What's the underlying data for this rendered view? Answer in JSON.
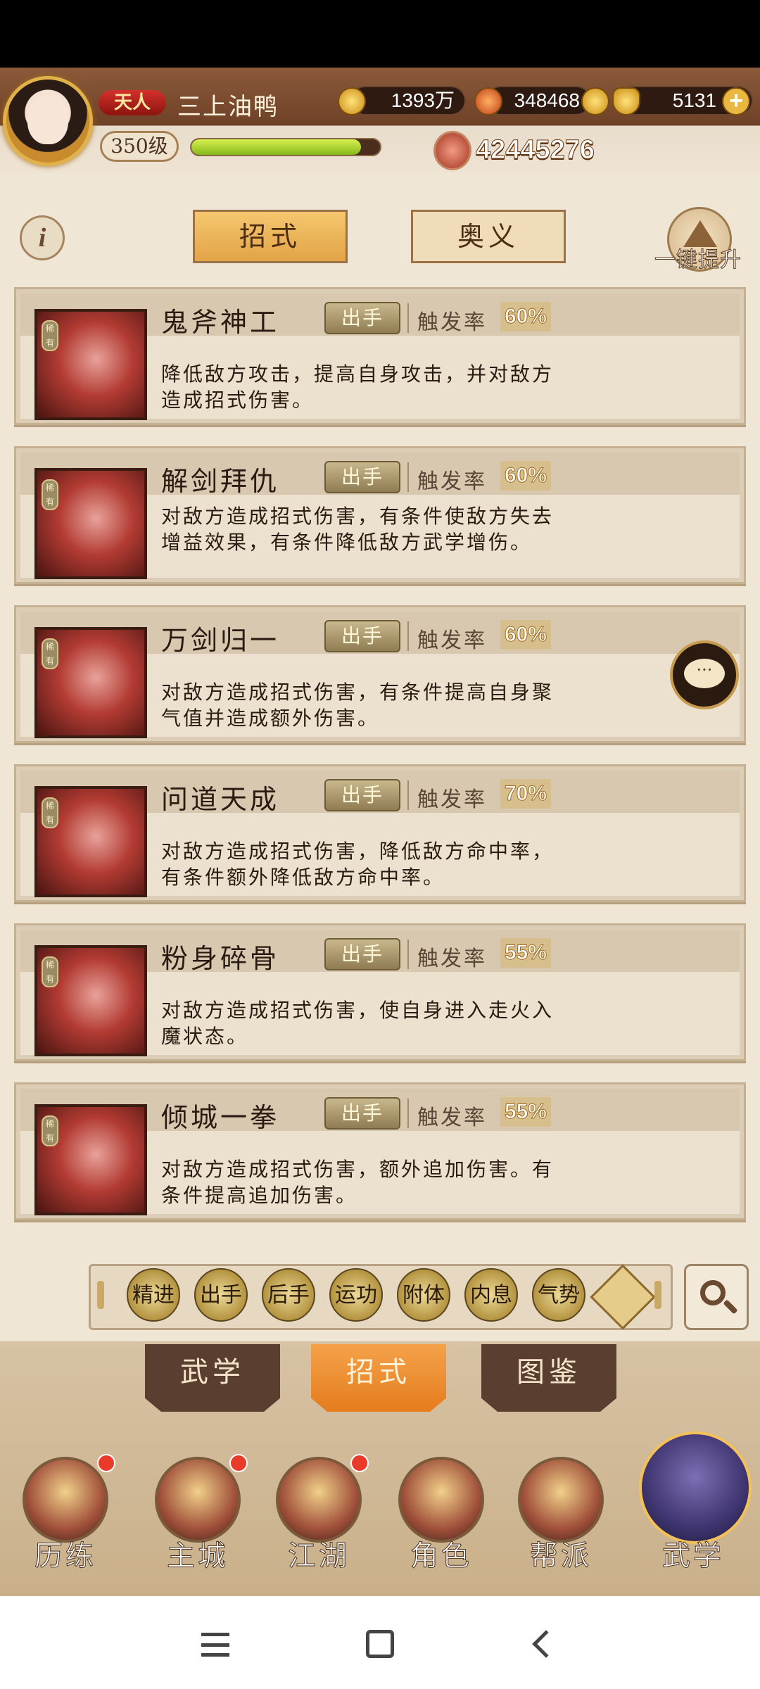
{
  "player": {
    "rank_badge": "天人",
    "name": "三上油鸭",
    "level": "350级",
    "exp_progress": 0.9,
    "power": "42445276"
  },
  "currencies": [
    {
      "name": "silver",
      "value": "1393万"
    },
    {
      "name": "sycee",
      "value": "348468"
    },
    {
      "name": "gold",
      "value": "5131"
    }
  ],
  "tabs": {
    "active": "招式",
    "other": "奥义"
  },
  "upgrade_label": "一键提升",
  "info_label": "i",
  "skills": [
    {
      "name": "鬼斧神工",
      "type": "出手",
      "rate_label": "触发率",
      "rate": "60%",
      "desc": "降低敌方攻击，提高自身攻击，并对敌方造成招式伤害。",
      "tag": "稀有"
    },
    {
      "name": "解剑拜仇",
      "type": "出手",
      "rate_label": "触发率",
      "rate": "60%",
      "desc": "对敌方造成招式伤害，有条件使敌方失去增益效果，有条件降低敌方武学增伤。",
      "tag": "稀有"
    },
    {
      "name": "万剑归一",
      "type": "出手",
      "rate_label": "触发率",
      "rate": "60%",
      "desc": "对敌方造成招式伤害，有条件提高自身聚气值并造成额外伤害。",
      "tag": "稀有"
    },
    {
      "name": "问道天成",
      "type": "出手",
      "rate_label": "触发率",
      "rate": "70%",
      "desc": "对敌方造成招式伤害，降低敌方命中率，有条件额外降低敌方命中率。",
      "tag": "稀有"
    },
    {
      "name": "粉身碎骨",
      "type": "出手",
      "rate_label": "触发率",
      "rate": "55%",
      "desc": "对敌方造成招式伤害，使自身进入走火入魔状态。",
      "tag": "稀有"
    },
    {
      "name": "倾城一拳",
      "type": "出手",
      "rate_label": "触发率",
      "rate": "55%",
      "desc": "对敌方造成招式伤害，额外追加伤害。有条件提高追加伤害。",
      "tag": "稀有"
    }
  ],
  "chat_label": "···",
  "filters": [
    "精进",
    "出手",
    "后手",
    "运功",
    "附体",
    "内息",
    "气势"
  ],
  "sub_tabs": [
    "武学",
    "招式",
    "图鉴"
  ],
  "nav": [
    "历练",
    "主城",
    "江湖",
    "角色",
    "帮派",
    "武学"
  ]
}
